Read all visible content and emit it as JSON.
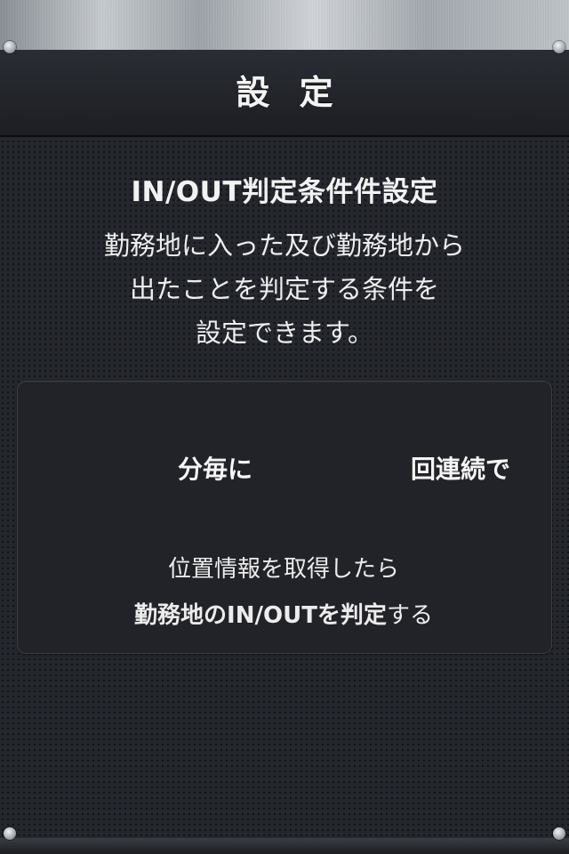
{
  "header": {
    "title": "設 定"
  },
  "section": {
    "title": "IN/OUT判定条件件設定",
    "description_lines": [
      "勤務地に入った及び勤務地から",
      "出たことを判定する条件を",
      "設定できます。"
    ]
  },
  "condition_panel": {
    "minutes_label": "分毎に",
    "times_label": "回連続で",
    "desc_line1": "位置情報を取得したら",
    "desc_line2_bold": "勤務地のIN/OUTを判定",
    "desc_line2_normal": "する"
  },
  "colors": {
    "background": "#24272d",
    "header": "#1c1e23",
    "panel": "#222328",
    "text": "#f2f2f2"
  }
}
